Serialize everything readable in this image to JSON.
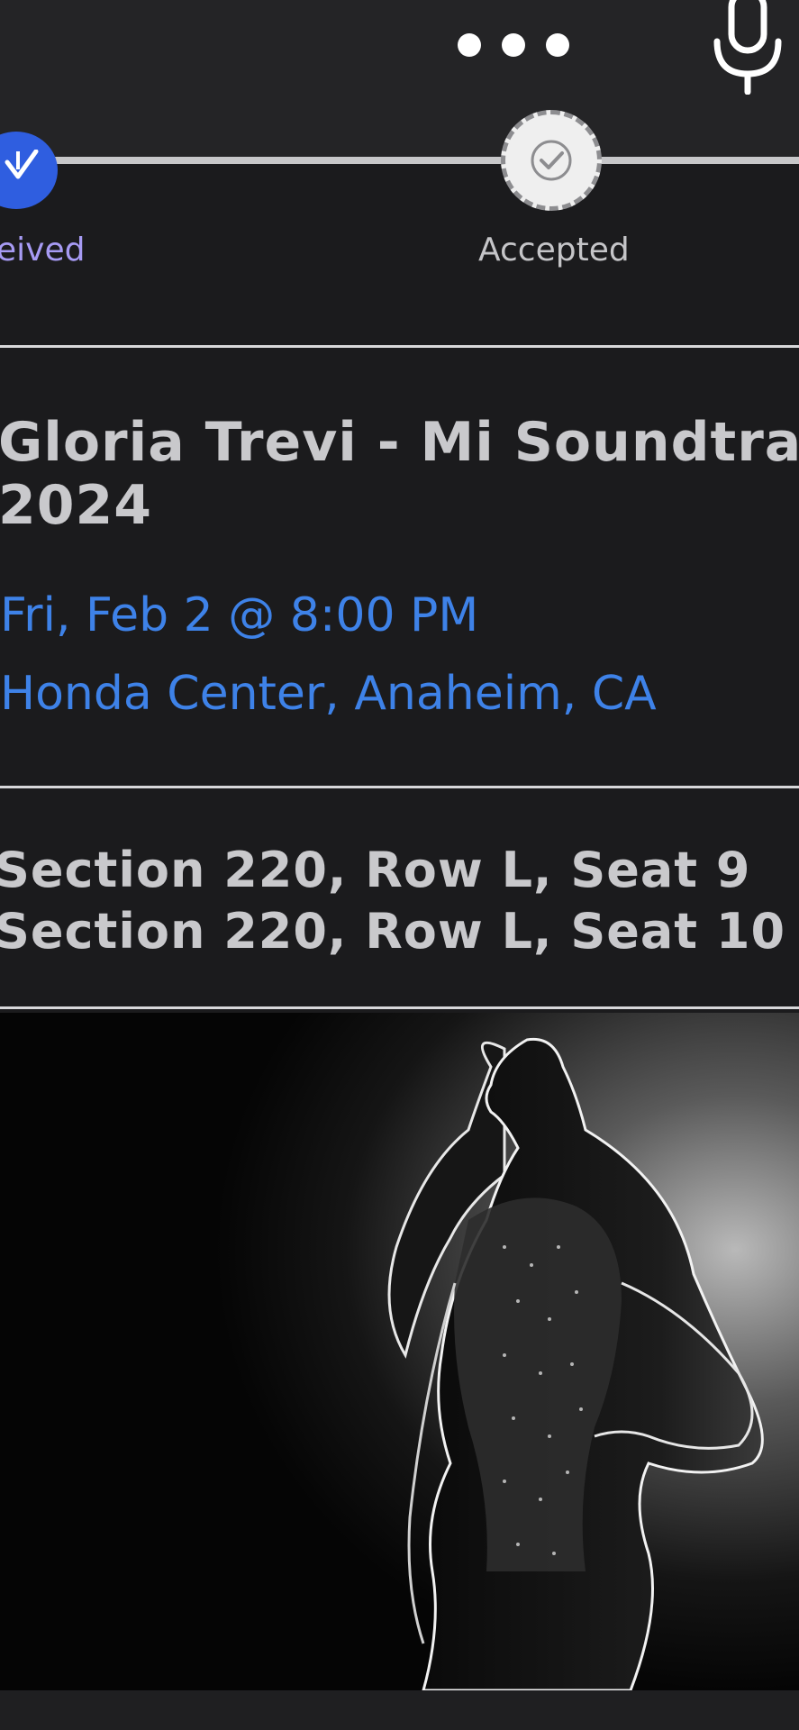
{
  "header": {
    "more_icon": "more-horizontal-icon",
    "mic_icon": "microphone-icon"
  },
  "progress": {
    "steps": [
      {
        "label": "eived",
        "icon": "download-check-icon",
        "state": "complete",
        "color": "#2f5ee0"
      },
      {
        "label": "Accepted",
        "icon": "check-circle-icon",
        "state": "pending"
      }
    ]
  },
  "event": {
    "title_line1": "Gloria Trevi - Mi Soundtrac",
    "title_line2": "2024",
    "date": "Fri, Feb 2 @ 8:00 PM",
    "venue": "Honda Center, Anaheim, CA",
    "accent_color": "#3e82e8"
  },
  "seats": [
    "Section 220, Row L, Seat 9",
    "Section 220, Row L, Seat 10"
  ],
  "hero": {
    "image": "performer-silhouette-photo"
  }
}
